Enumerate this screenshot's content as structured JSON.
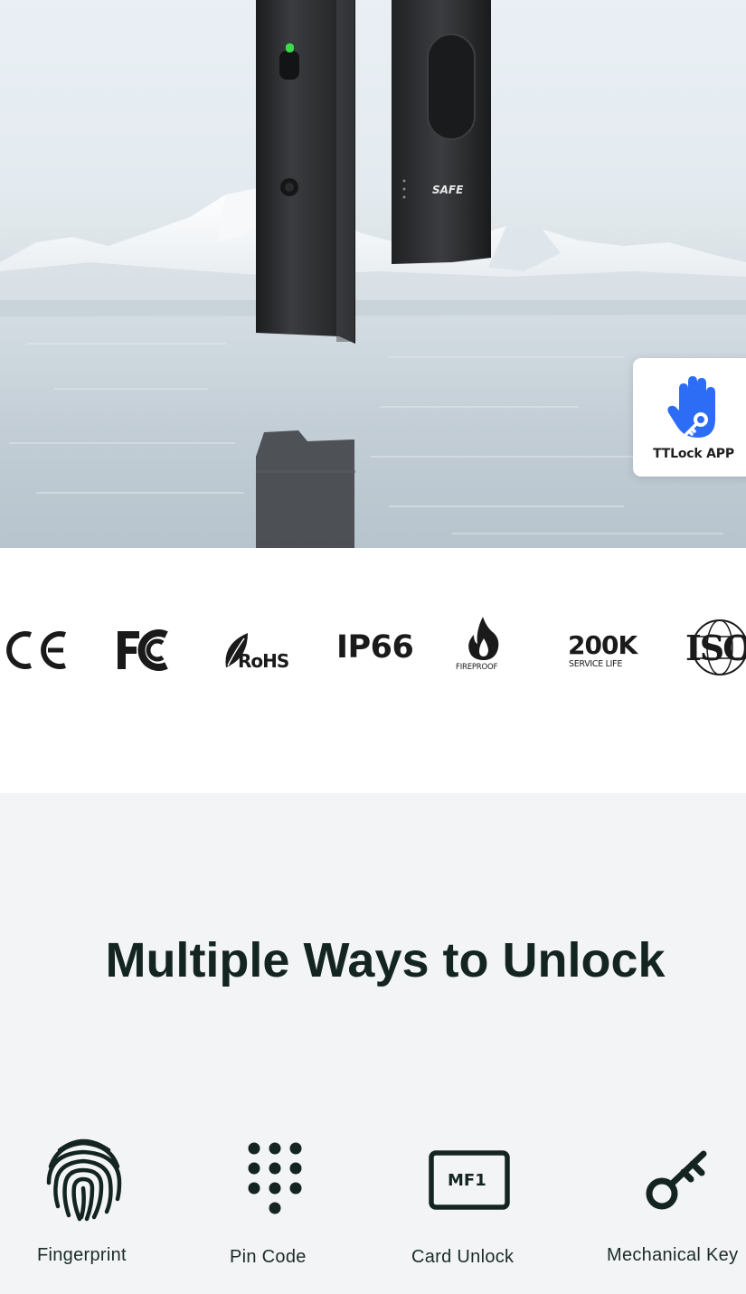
{
  "hero": {
    "product_brand": "SAFE",
    "app_badge": {
      "label": "TTLock APP",
      "icon": "hand-key-icon",
      "color": "#2d6df6"
    }
  },
  "certifications": [
    {
      "id": "ce",
      "text": "CE"
    },
    {
      "id": "fcc",
      "text": "FC"
    },
    {
      "id": "rohs",
      "text": "RoHS"
    },
    {
      "id": "ip66",
      "text": "IP66"
    },
    {
      "id": "fireproof",
      "text": "FIREPROOF",
      "icon": "flame-icon"
    },
    {
      "id": "service-life",
      "text": "200K",
      "sub": "SERVICE LIFE"
    },
    {
      "id": "iso",
      "text": "ISO"
    }
  ],
  "unlock": {
    "title": "Multiple Ways to Unlock",
    "methods": [
      {
        "label": "Fingerprint",
        "icon": "fingerprint-icon"
      },
      {
        "label": "Pin Code",
        "icon": "keypad-icon"
      },
      {
        "label": "Card Unlock",
        "icon": "card-icon",
        "card_text": "MF1"
      },
      {
        "label": "Mechanical Key",
        "icon": "key-icon"
      }
    ]
  },
  "colors": {
    "accent": "#2d6df6",
    "text": "#142521",
    "section_bg": "#f3f4f6",
    "indicator": "#3bdc4a"
  }
}
